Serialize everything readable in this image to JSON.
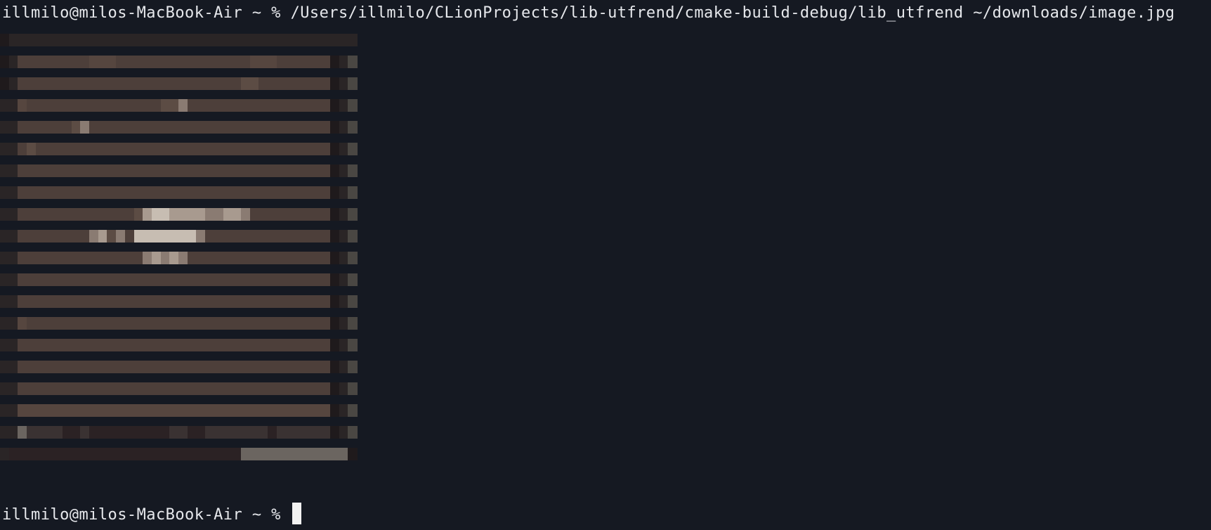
{
  "terminal": {
    "prompt": "illmilo@milos-MacBook-Air ~ %",
    "command": "/Users/illmilo/CLionProjects/lib-utfrend/cmake-build-debug/lib_utfrend ~/downloads/image.jpg",
    "final_prompt": "illmilo@milos-MacBook-Air ~ %",
    "colors": {
      "background": "#151922",
      "text": "#e6e8ec",
      "cursor": "#f2f2f2"
    }
  },
  "image_render": {
    "description_kind": "half-block pixel rendering",
    "columns": 40,
    "rows": 20,
    "palette": {
      "edge_dark": "#1f1a1c",
      "edge_mid": "#2a2526",
      "edge_light": "#4a4743",
      "base": "#4d3f3a",
      "base_alt": "#56463f",
      "warm": "#5c4c44",
      "light": "#8a7b72",
      "highlight": "#c7bdb2",
      "highlight_mid": "#a89a8f",
      "bottom_dark": "#2b2224",
      "bottom_mid": "#3a3232",
      "bottom_light": "#6b6560"
    },
    "pixels": [
      [
        "edge_dark",
        "edge_mid",
        "edge_mid",
        "edge_mid",
        "edge_mid",
        "edge_mid",
        "edge_mid",
        "edge_mid",
        "edge_mid",
        "edge_mid",
        "edge_mid",
        "edge_mid",
        "edge_mid",
        "edge_mid",
        "edge_mid",
        "edge_mid",
        "edge_mid",
        "edge_mid",
        "edge_mid",
        "edge_mid",
        "edge_mid",
        "edge_mid",
        "edge_mid",
        "edge_mid",
        "edge_mid",
        "edge_mid",
        "edge_mid",
        "edge_mid",
        "edge_mid",
        "edge_mid",
        "edge_mid",
        "edge_mid",
        "edge_mid",
        "edge_mid",
        "edge_mid",
        "edge_mid",
        "edge_mid",
        "edge_mid",
        "edge_mid",
        "edge_mid"
      ],
      [
        "edge_dark",
        "edge_mid",
        "base",
        "base",
        "base",
        "base",
        "base",
        "base",
        "base",
        "base",
        "base_alt",
        "base_alt",
        "base_alt",
        "base",
        "base",
        "base",
        "base",
        "base",
        "base",
        "base",
        "base",
        "base",
        "base",
        "base",
        "base",
        "base",
        "base",
        "base",
        "base_alt",
        "base_alt",
        "base_alt",
        "base",
        "base",
        "base",
        "base",
        "base",
        "base",
        "edge_dark",
        "edge_mid",
        "edge_light"
      ],
      [
        "edge_dark",
        "edge_mid",
        "base",
        "base",
        "base",
        "base",
        "base",
        "base",
        "base",
        "base",
        "base",
        "base",
        "base",
        "base",
        "base",
        "base",
        "base",
        "base",
        "base",
        "base",
        "base",
        "base",
        "base",
        "base",
        "base",
        "base",
        "base",
        "warm",
        "warm",
        "base",
        "base",
        "base",
        "base",
        "base",
        "base",
        "base",
        "base",
        "edge_dark",
        "edge_mid",
        "edge_light"
      ],
      [
        "edge_mid",
        "edge_mid",
        "base_alt",
        "base",
        "base",
        "base",
        "base",
        "base",
        "base",
        "base",
        "base",
        "base",
        "base",
        "base",
        "base",
        "base",
        "base",
        "base",
        "warm",
        "warm",
        "light",
        "base",
        "base",
        "base",
        "base",
        "base",
        "base",
        "base",
        "base",
        "base",
        "base",
        "base",
        "base",
        "base",
        "base",
        "base",
        "base",
        "edge_dark",
        "edge_mid",
        "edge_light"
      ],
      [
        "edge_mid",
        "edge_mid",
        "base",
        "base",
        "base",
        "base",
        "base",
        "base",
        "warm",
        "light",
        "base",
        "base",
        "base",
        "base",
        "base",
        "base",
        "base",
        "base",
        "base",
        "base",
        "base",
        "base",
        "base",
        "base",
        "base",
        "base",
        "base",
        "base",
        "base",
        "base",
        "base",
        "base",
        "base",
        "base",
        "base",
        "base",
        "base",
        "edge_dark",
        "edge_mid",
        "edge_light"
      ],
      [
        "edge_mid",
        "edge_mid",
        "base",
        "warm",
        "base",
        "base",
        "base",
        "base",
        "base",
        "base",
        "base",
        "base",
        "base",
        "base",
        "base",
        "base",
        "base",
        "base",
        "base",
        "base",
        "base",
        "base",
        "base",
        "base",
        "base",
        "base",
        "base",
        "base",
        "base",
        "base",
        "base",
        "base",
        "base",
        "base",
        "base",
        "base",
        "base",
        "edge_dark",
        "edge_mid",
        "edge_light"
      ],
      [
        "edge_mid",
        "edge_mid",
        "base",
        "base",
        "base",
        "base",
        "base",
        "base",
        "base",
        "base",
        "base",
        "base",
        "base",
        "base",
        "base",
        "base",
        "base",
        "base",
        "base",
        "base",
        "base",
        "base",
        "base",
        "base",
        "base",
        "base",
        "base",
        "base",
        "base",
        "base",
        "base",
        "base",
        "base",
        "base",
        "base",
        "base",
        "base",
        "edge_dark",
        "edge_mid",
        "edge_light"
      ],
      [
        "edge_mid",
        "edge_mid",
        "base",
        "base",
        "base",
        "base",
        "base",
        "base",
        "base",
        "base",
        "base",
        "base",
        "base",
        "base",
        "base",
        "base",
        "base",
        "base",
        "base",
        "base",
        "base",
        "base",
        "base",
        "base",
        "base",
        "base",
        "base",
        "base",
        "base",
        "base",
        "base",
        "base",
        "base",
        "base",
        "base",
        "base",
        "base",
        "edge_dark",
        "edge_mid",
        "edge_light"
      ],
      [
        "edge_mid",
        "edge_mid",
        "base",
        "base",
        "base",
        "base",
        "base",
        "base",
        "base",
        "base",
        "base",
        "base",
        "base",
        "base",
        "base",
        "warm",
        "highlight_mid",
        "highlight",
        "highlight",
        "highlight_mid",
        "highlight_mid",
        "highlight_mid",
        "highlight_mid",
        "light",
        "light",
        "highlight_mid",
        "highlight_mid",
        "light",
        "base",
        "base",
        "base",
        "base",
        "base",
        "base",
        "base",
        "base",
        "base",
        "edge_dark",
        "edge_mid",
        "edge_light"
      ],
      [
        "edge_mid",
        "edge_mid",
        "base",
        "base",
        "base",
        "base",
        "base",
        "base",
        "base",
        "base",
        "light",
        "highlight_mid",
        "warm",
        "light",
        "base",
        "highlight",
        "highlight",
        "highlight",
        "highlight",
        "highlight",
        "highlight",
        "highlight",
        "light",
        "base",
        "base",
        "base",
        "base",
        "base",
        "base",
        "base",
        "base",
        "base",
        "base",
        "base",
        "base",
        "base",
        "base",
        "edge_dark",
        "edge_mid",
        "edge_light"
      ],
      [
        "edge_mid",
        "edge_mid",
        "base",
        "base",
        "base",
        "base",
        "base",
        "base",
        "base",
        "base",
        "base",
        "base",
        "base",
        "base",
        "base",
        "base",
        "light",
        "highlight_mid",
        "light",
        "highlight_mid",
        "light",
        "base",
        "base",
        "base",
        "base",
        "base",
        "base",
        "base",
        "base",
        "base",
        "base",
        "base",
        "base",
        "base",
        "base",
        "base",
        "base",
        "edge_dark",
        "edge_mid",
        "edge_light"
      ],
      [
        "edge_mid",
        "edge_mid",
        "base",
        "base",
        "base",
        "base",
        "base",
        "base",
        "base",
        "base",
        "base",
        "base",
        "base",
        "base",
        "base",
        "base",
        "base",
        "base",
        "base",
        "base",
        "base",
        "base",
        "base",
        "base",
        "base",
        "base",
        "base",
        "base",
        "base",
        "base",
        "base",
        "base",
        "base",
        "base",
        "base",
        "base",
        "base",
        "edge_dark",
        "edge_mid",
        "edge_light"
      ],
      [
        "edge_mid",
        "edge_mid",
        "base",
        "base",
        "base",
        "base",
        "base",
        "base",
        "base",
        "base",
        "base",
        "base",
        "base",
        "base",
        "base",
        "base",
        "base",
        "base",
        "base",
        "base",
        "base",
        "base",
        "base",
        "base",
        "base",
        "base",
        "base",
        "base",
        "base",
        "base",
        "base",
        "base",
        "base",
        "base",
        "base",
        "base",
        "base",
        "edge_dark",
        "edge_mid",
        "edge_light"
      ],
      [
        "edge_mid",
        "edge_mid",
        "base_alt",
        "base",
        "base",
        "base",
        "base",
        "base",
        "base",
        "base",
        "base",
        "base",
        "base",
        "base",
        "base",
        "base",
        "base",
        "base",
        "base",
        "base",
        "base",
        "base",
        "base",
        "base",
        "base",
        "base",
        "base",
        "base",
        "base",
        "base",
        "base",
        "base",
        "base",
        "base",
        "base",
        "base",
        "base",
        "edge_dark",
        "edge_mid",
        "edge_light"
      ],
      [
        "edge_mid",
        "edge_mid",
        "base",
        "base",
        "base",
        "base",
        "base",
        "base",
        "base",
        "base",
        "base",
        "base",
        "base",
        "base",
        "base",
        "base",
        "base",
        "base",
        "base",
        "base",
        "base",
        "base",
        "base",
        "base",
        "base",
        "base",
        "base",
        "base",
        "base",
        "base",
        "base",
        "base",
        "base",
        "base",
        "base",
        "base",
        "base",
        "edge_dark",
        "edge_mid",
        "edge_light"
      ],
      [
        "edge_mid",
        "edge_mid",
        "base",
        "base",
        "base",
        "base",
        "base",
        "base",
        "base",
        "base",
        "base",
        "base",
        "base",
        "base",
        "base",
        "base",
        "base",
        "base",
        "base",
        "base",
        "base",
        "base",
        "base",
        "base",
        "base",
        "base",
        "base",
        "base",
        "base",
        "base",
        "base",
        "base",
        "base",
        "base",
        "base",
        "base",
        "base",
        "edge_dark",
        "edge_mid",
        "edge_light"
      ],
      [
        "edge_mid",
        "edge_mid",
        "base",
        "base",
        "base",
        "base",
        "base",
        "base",
        "base",
        "base",
        "base",
        "base",
        "base",
        "base",
        "base",
        "base",
        "base",
        "base",
        "base",
        "base",
        "base",
        "base",
        "base",
        "base",
        "base",
        "base",
        "base",
        "base",
        "base",
        "base",
        "base",
        "base",
        "base",
        "base",
        "base",
        "base",
        "base",
        "edge_dark",
        "edge_mid",
        "edge_light"
      ],
      [
        "edge_mid",
        "edge_mid",
        "base_alt",
        "base_alt",
        "base_alt",
        "base_alt",
        "base_alt",
        "base_alt",
        "base_alt",
        "base_alt",
        "base_alt",
        "base_alt",
        "base_alt",
        "base_alt",
        "base_alt",
        "base_alt",
        "base_alt",
        "base_alt",
        "base_alt",
        "base_alt",
        "base_alt",
        "base_alt",
        "base_alt",
        "base_alt",
        "base_alt",
        "base_alt",
        "base_alt",
        "base_alt",
        "base_alt",
        "base_alt",
        "base_alt",
        "base_alt",
        "base_alt",
        "base_alt",
        "base_alt",
        "base_alt",
        "base_alt",
        "edge_dark",
        "edge_mid",
        "edge_light"
      ],
      [
        "edge_mid",
        "edge_mid",
        "bottom_light",
        "bottom_mid",
        "bottom_mid",
        "bottom_mid",
        "bottom_mid",
        "bottom_dark",
        "bottom_dark",
        "bottom_mid",
        "bottom_dark",
        "bottom_dark",
        "bottom_dark",
        "bottom_dark",
        "bottom_dark",
        "bottom_dark",
        "bottom_dark",
        "bottom_dark",
        "bottom_dark",
        "bottom_mid",
        "bottom_mid",
        "bottom_dark",
        "bottom_dark",
        "bottom_mid",
        "bottom_mid",
        "bottom_mid",
        "bottom_mid",
        "bottom_mid",
        "bottom_mid",
        "bottom_mid",
        "bottom_dark",
        "bottom_mid",
        "bottom_mid",
        "bottom_mid",
        "bottom_mid",
        "bottom_mid",
        "bottom_mid",
        "edge_dark",
        "edge_mid",
        "edge_light"
      ],
      [
        "edge_mid",
        "bottom_dark",
        "bottom_dark",
        "bottom_dark",
        "bottom_dark",
        "bottom_dark",
        "bottom_dark",
        "bottom_dark",
        "bottom_dark",
        "bottom_dark",
        "bottom_dark",
        "bottom_dark",
        "bottom_dark",
        "bottom_dark",
        "bottom_dark",
        "bottom_dark",
        "bottom_dark",
        "bottom_dark",
        "bottom_dark",
        "bottom_dark",
        "bottom_dark",
        "bottom_dark",
        "bottom_dark",
        "bottom_dark",
        "bottom_dark",
        "bottom_dark",
        "bottom_dark",
        "bottom_light",
        "bottom_light",
        "bottom_light",
        "bottom_light",
        "bottom_light",
        "bottom_light",
        "bottom_light",
        "bottom_light",
        "bottom_light",
        "bottom_light",
        "bottom_light",
        "bottom_light",
        "edge_dark"
      ]
    ]
  }
}
